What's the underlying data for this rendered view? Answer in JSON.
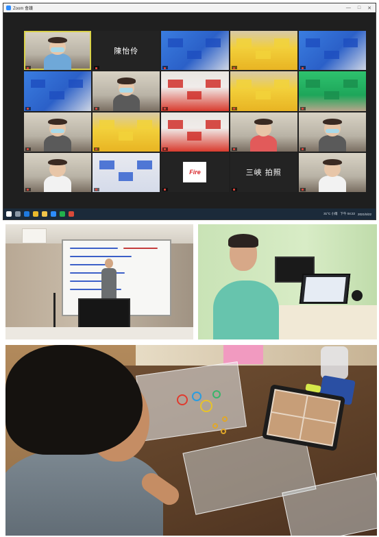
{
  "zoom_window": {
    "title": "Zoom 會議",
    "window_controls": [
      "—",
      "□",
      "✕"
    ],
    "tiles": [
      {
        "name": "",
        "type": "video",
        "scene": "room"
      },
      {
        "name": "陳怡伶",
        "type": "name_only"
      },
      {
        "name": "",
        "type": "video",
        "scene": "table-blue"
      },
      {
        "name": "",
        "type": "video",
        "scene": "table-yellow"
      },
      {
        "name": "",
        "type": "video",
        "scene": "table-blue"
      },
      {
        "name": "",
        "type": "video",
        "scene": "table-blue"
      },
      {
        "name": "",
        "type": "video",
        "scene": "room"
      },
      {
        "name": "",
        "type": "video",
        "scene": "table-red"
      },
      {
        "name": "",
        "type": "video",
        "scene": "table-yellow"
      },
      {
        "name": "",
        "type": "video",
        "scene": "table-green"
      },
      {
        "name": "",
        "type": "video",
        "scene": "room"
      },
      {
        "name": "",
        "type": "video",
        "scene": "table-yellow"
      },
      {
        "name": "",
        "type": "video",
        "scene": "table-red"
      },
      {
        "name": "",
        "type": "video",
        "scene": "room"
      },
      {
        "name": "",
        "type": "video",
        "scene": "room"
      },
      {
        "name": "",
        "type": "video",
        "scene": "room"
      },
      {
        "name": "",
        "type": "video",
        "scene": "table-pale"
      },
      {
        "name": "",
        "type": "logo",
        "logo_text": "Fire"
      },
      {
        "name": "三峽 拍照",
        "type": "name_only"
      },
      {
        "name": "",
        "type": "video",
        "scene": "room"
      }
    ],
    "taskbar": {
      "weather": "31°C 小雨",
      "time": "下午 04:22",
      "date": "2021/5/22"
    }
  },
  "colors": {
    "zoom_bg": "#1f1f1f",
    "active_speaker": "#d9d24a",
    "taskbar": "#1b2a3a"
  }
}
